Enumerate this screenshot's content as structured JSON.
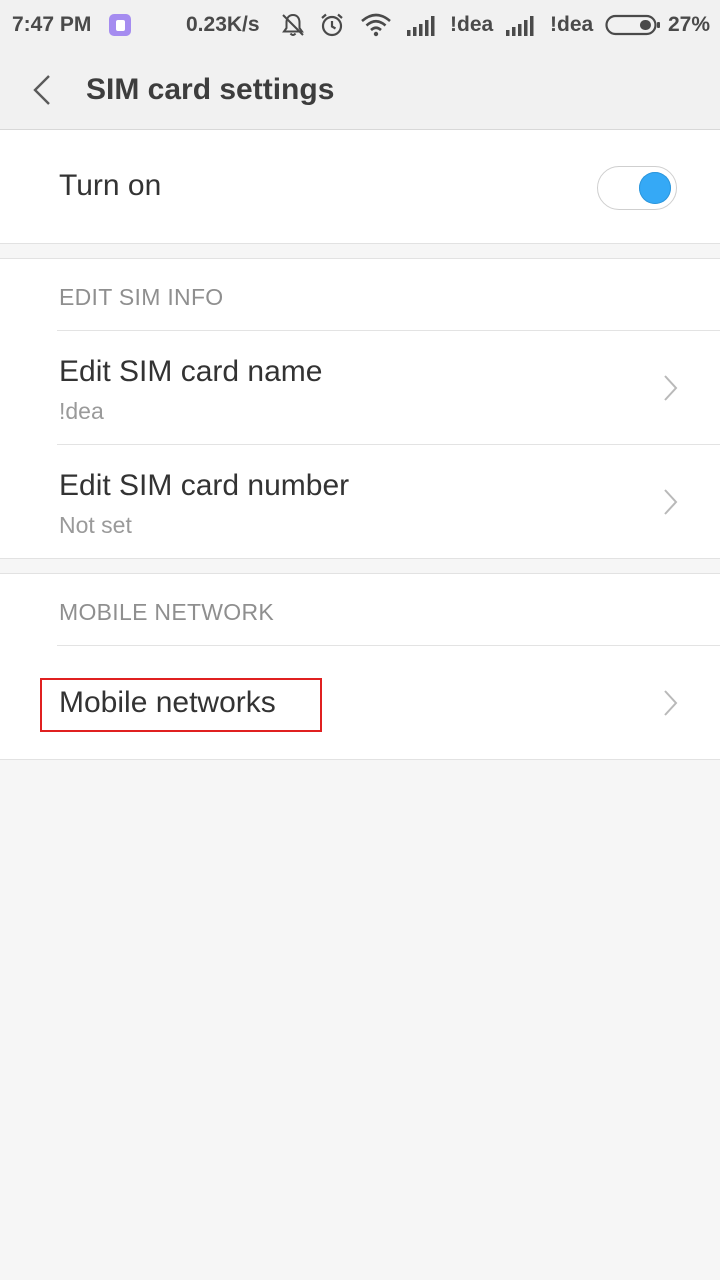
{
  "status_bar": {
    "time": "7:47 PM",
    "network_speed": "0.23K/s",
    "carrier_1": "!dea",
    "carrier_2": "!dea",
    "battery_percent": "27%",
    "icons": [
      "app-notification-icon",
      "bell-off-icon",
      "alarm-icon",
      "wifi-icon",
      "signal-icon",
      "signal-icon",
      "battery-icon"
    ],
    "app_badge_color": "#a58cf0",
    "battery_level": 0.27
  },
  "toolbar": {
    "title": "SIM card settings",
    "back_icon": "chevron-left-icon"
  },
  "toggle_row": {
    "label": "Turn on",
    "enabled": true,
    "accent_color": "#35a9f6"
  },
  "sim_info": {
    "header": "EDIT SIM INFO",
    "items": [
      {
        "label": "Edit SIM card name",
        "value": "!dea"
      },
      {
        "label": "Edit SIM card number",
        "value": "Not set"
      }
    ]
  },
  "mobile_network": {
    "header": "MOBILE NETWORK",
    "items": [
      {
        "label": "Mobile networks"
      }
    ]
  },
  "colors": {
    "highlight": "#e02020",
    "background": "#f6f6f6"
  }
}
